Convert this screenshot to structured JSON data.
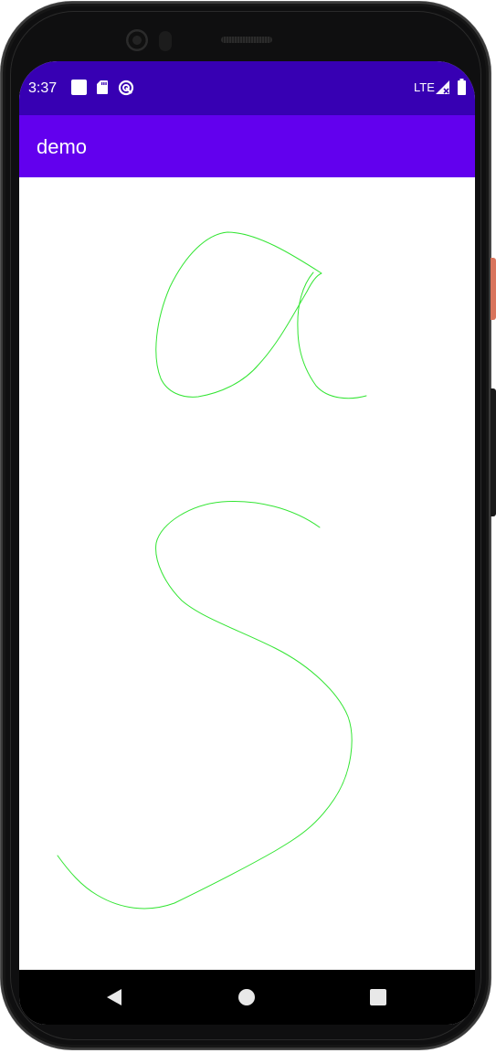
{
  "status_bar": {
    "time": "3:37",
    "network": "LTE",
    "icons": [
      "notification-square-icon",
      "sd-card-icon",
      "sync-icon",
      "signal-icon",
      "battery-icon"
    ],
    "background_color": "#3700b3"
  },
  "app_bar": {
    "title": "demo",
    "background_color": "#6200ee"
  },
  "canvas": {
    "stroke_color": "#33e533",
    "strokes": [
      {
        "name": "letter-a-bowl"
      },
      {
        "name": "letter-a-stem"
      },
      {
        "name": "letter-s"
      }
    ]
  },
  "nav_bar": {
    "buttons": [
      "back-icon",
      "home-icon",
      "recents-icon"
    ]
  }
}
